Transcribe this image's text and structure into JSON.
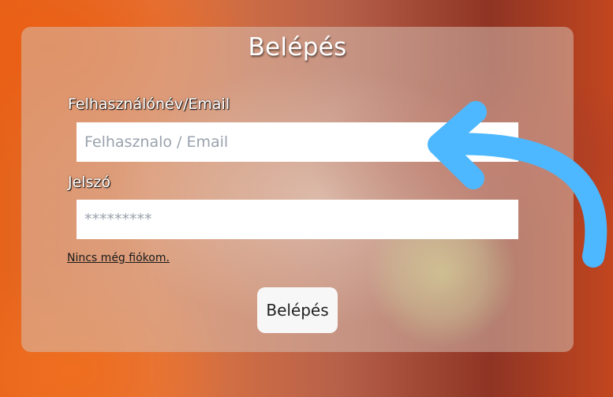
{
  "form": {
    "title": "Belépés",
    "username_label": "Felhasználónév/Email",
    "username_placeholder": "Felhasznalo / Email",
    "password_label": "Jelszó",
    "password_placeholder": "*********",
    "signup_link": "Nincs még fiókom.",
    "submit_label": "Belépés"
  },
  "annotation": {
    "arrow_icon": "curved-arrow-pointing-to-username-field",
    "arrow_color": "#4db8ff"
  }
}
